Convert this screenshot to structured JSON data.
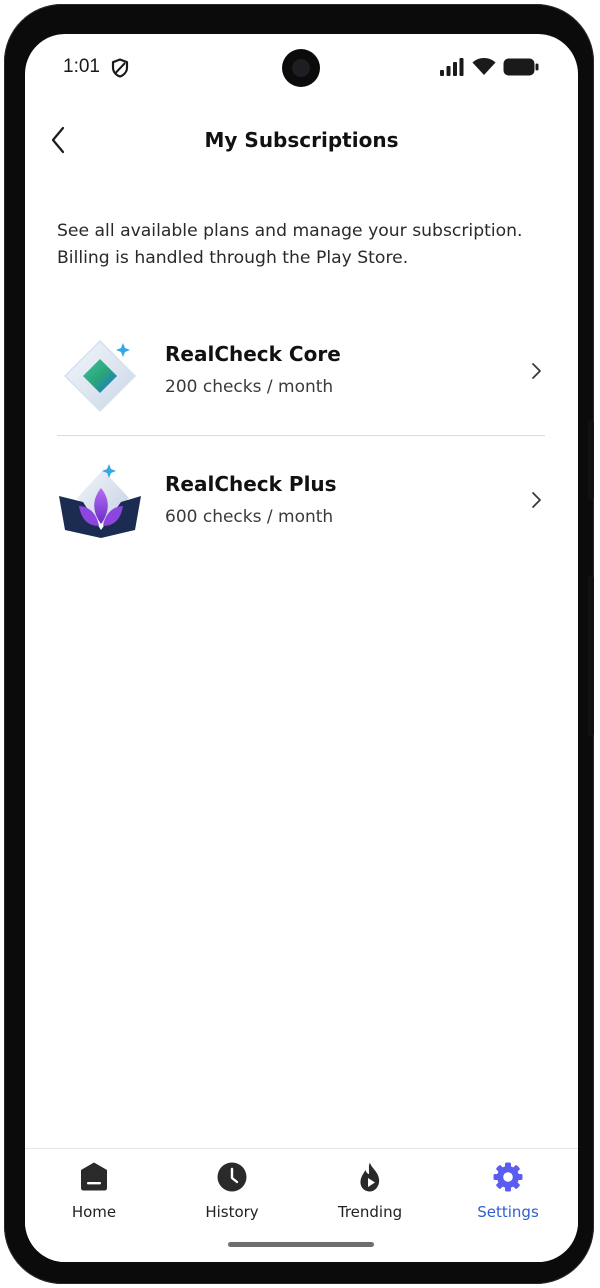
{
  "status_bar": {
    "time": "1:01"
  },
  "header": {
    "title": "My Subscriptions",
    "back_icon": "chevron-left-icon"
  },
  "description": "See all available plans and manage your subscription. Billing is handled through the Play Store.",
  "plans": [
    {
      "name": "RealCheck Core",
      "detail": "200 checks / month",
      "icon": "core-plan-icon"
    },
    {
      "name": "RealCheck Plus",
      "detail": "600 checks / month",
      "icon": "plus-plan-icon"
    }
  ],
  "bottom_nav": {
    "items": [
      {
        "label": "Home",
        "icon": "home-icon",
        "active": false
      },
      {
        "label": "History",
        "icon": "clock-icon",
        "active": false
      },
      {
        "label": "Trending",
        "icon": "flame-icon",
        "active": false
      },
      {
        "label": "Settings",
        "icon": "gear-icon",
        "active": true
      }
    ]
  },
  "colors": {
    "accent": "#2f5fd0",
    "settings_icon": "#5b5cf0",
    "text": "#111111"
  }
}
